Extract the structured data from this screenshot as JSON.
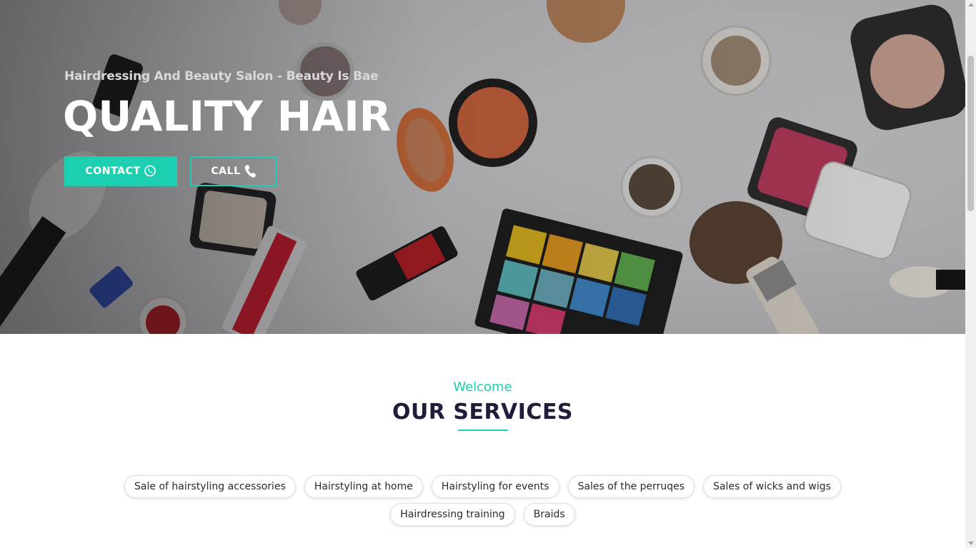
{
  "hero": {
    "subtitle": "Hairdressing And Beauty Salon - Beauty Is Bae",
    "title": "QUALITY HAIR",
    "buttons": {
      "contact_label": "CONTACT",
      "contact_icon": "whatsapp-icon",
      "call_label": "CALL",
      "call_icon": "phone-icon"
    },
    "background_image": "makeup-products-flatlay"
  },
  "services": {
    "eyebrow": "Welcome",
    "title": "OUR SERVICES",
    "items": [
      "Sale of hairstyling accessories",
      "Hairstyling at home",
      "Hairstyling for events",
      "Sales of the perruqes",
      "Sales of wicks and wigs",
      "Hairdressing training",
      "Braids"
    ]
  },
  "colors": {
    "accent": "#1ccfb0",
    "title_dark": "#241a3a",
    "hero_text": "#ffffff"
  }
}
